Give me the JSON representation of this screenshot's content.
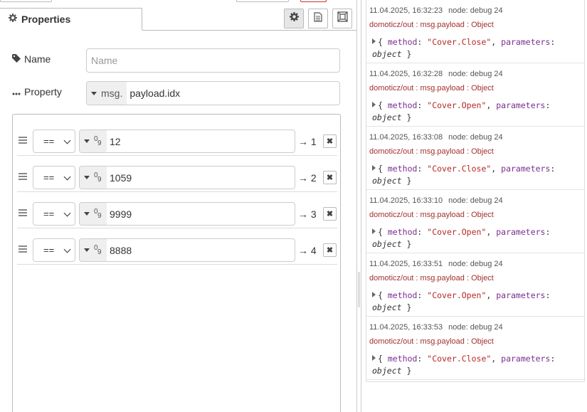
{
  "tab": {
    "label": "Properties",
    "icon": "gear-icon"
  },
  "tab_buttons": [
    {
      "name": "settings-tab-button",
      "icon": "gear-icon",
      "selected": true
    },
    {
      "name": "description-tab-button",
      "icon": "document-icon",
      "selected": false
    },
    {
      "name": "appearance-tab-button",
      "icon": "frame-icon",
      "selected": false
    }
  ],
  "name_field": {
    "label": "Name",
    "placeholder": "Name",
    "icon": "tag-icon"
  },
  "property_field": {
    "label": "Property",
    "type_label": "msg.",
    "value": "payload.idx",
    "icon": "ellipsis-icon"
  },
  "rules": [
    {
      "operator": "==",
      "value": "12",
      "output": "→ 1"
    },
    {
      "operator": "==",
      "value": "1059",
      "output": "→ 2"
    },
    {
      "operator": "==",
      "value": "9999",
      "output": "→ 3"
    },
    {
      "operator": "==",
      "value": "8888",
      "output": "→ 4"
    }
  ],
  "rule_type_icon": "0/9 number icon",
  "delete_glyph": "✖",
  "debug_messages": [
    {
      "time": "11.04.2025, 16:32:23",
      "node": "node: debug 24",
      "topic": "domoticz/out : msg.payload : Object",
      "method": "\"Cover.Close\""
    },
    {
      "time": "11.04.2025, 16:32:28",
      "node": "node: debug 24",
      "topic": "domoticz/out : msg.payload : Object",
      "method": "\"Cover.Open\""
    },
    {
      "time": "11.04.2025, 16:33:08",
      "node": "node: debug 24",
      "topic": "domoticz/out : msg.payload : Object",
      "method": "\"Cover.Close\""
    },
    {
      "time": "11.04.2025, 16:33:10",
      "node": "node: debug 24",
      "topic": "domoticz/out : msg.payload : Object",
      "method": "\"Cover.Open\""
    },
    {
      "time": "11.04.2025, 16:33:51",
      "node": "node: debug 24",
      "topic": "domoticz/out : msg.payload : Object",
      "method": "\"Cover.Open\""
    },
    {
      "time": "11.04.2025, 16:33:53",
      "node": "node: debug 24",
      "topic": "domoticz/out : msg.payload : Object",
      "method": "\"Cover.Close\""
    }
  ],
  "debug_body": {
    "open_brace": "{",
    "method_key": "method",
    "params_key": "parameters",
    "params_type": "object",
    "close_brace": "}"
  },
  "colors": {
    "topic": "#a23030",
    "key": "#792e90",
    "string": "#b72828"
  }
}
